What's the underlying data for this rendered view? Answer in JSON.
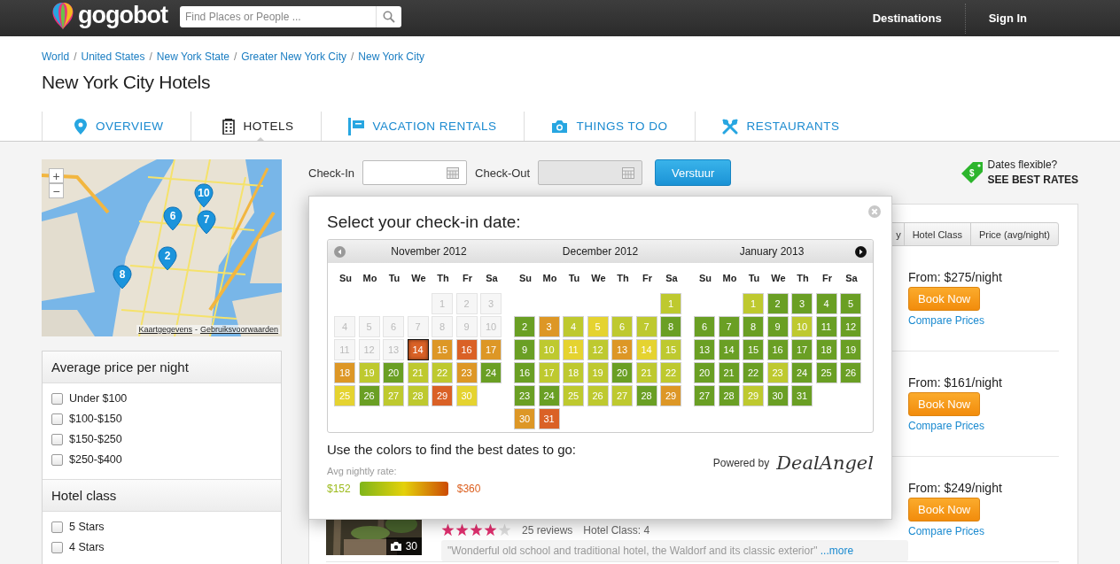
{
  "header": {
    "logo": "gogobot",
    "search": {
      "placeholder": "Find Places or People ..."
    },
    "links": [
      "Destinations",
      "Sign In"
    ]
  },
  "breadcrumb": {
    "separator": "/",
    "items": [
      "World",
      "United States",
      "New York State",
      "Greater New York City",
      "New York City"
    ]
  },
  "title": "New York City Hotels",
  "tabs": [
    {
      "label": "OVERVIEW",
      "kind": "pin",
      "selected": false
    },
    {
      "label": "HOTELS",
      "kind": "building",
      "selected": true
    },
    {
      "label": "VACATION RENTALS",
      "kind": "sign",
      "selected": false
    },
    {
      "label": "THINGS TO DO",
      "kind": "camera",
      "selected": false
    },
    {
      "label": "RESTAURANTS",
      "kind": "utensils",
      "selected": false
    }
  ],
  "map": {
    "zoom_in": "+",
    "zoom_out": "−",
    "markers": [
      "10",
      "6",
      "7",
      "2",
      "8"
    ],
    "links": [
      "Kaartgegevens",
      "Gebruiksvoorwaarden"
    ],
    "separator": "-"
  },
  "filters": [
    {
      "title": "Average price per night",
      "options": [
        {
          "label": "Under $100",
          "checked": false
        },
        {
          "label": "$100-$150",
          "checked": false
        },
        {
          "label": "$150-$250",
          "checked": false
        },
        {
          "label": "$250-$400",
          "checked": false
        }
      ]
    },
    {
      "title": "Hotel class",
      "options": [
        {
          "label": "5 Stars",
          "checked": false
        },
        {
          "label": "4 Stars",
          "checked": false
        }
      ]
    }
  ],
  "search_form": {
    "checkin_label": "Check-In",
    "checkout_label": "Check-Out",
    "checkout_disabled": true,
    "submit": "Verstuur"
  },
  "flexible": {
    "tag_symbol": "$",
    "question": "Dates flexible?",
    "link": "SEE BEST RATES"
  },
  "sort_buttons": [
    "y",
    "Hotel Class",
    "Price (avg/night)"
  ],
  "hotels": [
    {
      "price": "From: $275/night",
      "book": "Book Now",
      "compare": "Compare Prices"
    },
    {
      "price": "From: $161/night",
      "book": "Book Now",
      "compare": "Compare Prices"
    },
    {
      "price": "From: $249/night",
      "book": "Book Now",
      "compare": "Compare Prices",
      "photo_count": "30",
      "stars": 4,
      "reviews": "25 reviews",
      "hotel_class": "Hotel Class: 4",
      "quote": "\"Wonderful old school and traditional hotel, the Waldorf and its classic exterior\"",
      "more": "...more"
    }
  ],
  "datepicker": {
    "title": "Select your check-in date:",
    "months": [
      {
        "name": "November 2012",
        "weekdays": [
          "Su",
          "Mo",
          "Tu",
          "We",
          "Th",
          "Fr",
          "Sa"
        ],
        "weeks": [
          [
            {
              "kind": "blank"
            },
            {
              "kind": "blank"
            },
            {
              "kind": "blank"
            },
            {
              "kind": "blank"
            },
            {
              "kind": "day",
              "day": "1",
              "disabled": true,
              "selected": false
            },
            {
              "kind": "day",
              "day": "2",
              "disabled": true,
              "selected": false
            },
            {
              "kind": "day",
              "day": "3",
              "disabled": true,
              "selected": false
            }
          ],
          [
            {
              "kind": "day",
              "day": "4",
              "disabled": true,
              "selected": false
            },
            {
              "kind": "day",
              "day": "5",
              "disabled": true,
              "selected": false
            },
            {
              "kind": "day",
              "day": "6",
              "disabled": true,
              "selected": false
            },
            {
              "kind": "day",
              "day": "7",
              "disabled": true,
              "selected": false
            },
            {
              "kind": "day",
              "day": "8",
              "disabled": true,
              "selected": false
            },
            {
              "kind": "day",
              "day": "9",
              "disabled": true,
              "selected": false
            },
            {
              "kind": "day",
              "day": "10",
              "disabled": true,
              "selected": false
            }
          ],
          [
            {
              "kind": "day",
              "day": "11",
              "disabled": true,
              "selected": false
            },
            {
              "kind": "day",
              "day": "12",
              "disabled": true,
              "selected": false
            },
            {
              "kind": "day",
              "day": "13",
              "disabled": true,
              "selected": false
            },
            {
              "kind": "day",
              "day": "14",
              "disabled": false,
              "selected": true,
              "color": "#da6126"
            },
            {
              "kind": "day",
              "day": "15",
              "disabled": false,
              "selected": false,
              "color": "#dd9726"
            },
            {
              "kind": "day",
              "day": "16",
              "disabled": false,
              "selected": false,
              "color": "#da6126"
            },
            {
              "kind": "day",
              "day": "17",
              "disabled": false,
              "selected": false,
              "color": "#dd9726"
            }
          ],
          [
            {
              "kind": "day",
              "day": "18",
              "disabled": false,
              "selected": false,
              "color": "#dd9726"
            },
            {
              "kind": "day",
              "day": "19",
              "disabled": false,
              "selected": false,
              "color": "#bec92f"
            },
            {
              "kind": "day",
              "day": "20",
              "disabled": false,
              "selected": false,
              "color": "#6a9f24"
            },
            {
              "kind": "day",
              "day": "21",
              "disabled": false,
              "selected": false,
              "color": "#bec92f"
            },
            {
              "kind": "day",
              "day": "22",
              "disabled": false,
              "selected": false,
              "color": "#bec92f"
            },
            {
              "kind": "day",
              "day": "23",
              "disabled": false,
              "selected": false,
              "color": "#dd9726"
            },
            {
              "kind": "day",
              "day": "24",
              "disabled": false,
              "selected": false,
              "color": "#6a9f24"
            }
          ],
          [
            {
              "kind": "day",
              "day": "25",
              "disabled": false,
              "selected": false,
              "color": "#e5d330"
            },
            {
              "kind": "day",
              "day": "26",
              "disabled": false,
              "selected": false,
              "color": "#6a9f24"
            },
            {
              "kind": "day",
              "day": "27",
              "disabled": false,
              "selected": false,
              "color": "#bec92f"
            },
            {
              "kind": "day",
              "day": "28",
              "disabled": false,
              "selected": false,
              "color": "#bec92f"
            },
            {
              "kind": "day",
              "day": "29",
              "disabled": false,
              "selected": false,
              "color": "#da6126"
            },
            {
              "kind": "day",
              "day": "30",
              "disabled": false,
              "selected": false,
              "color": "#e5d330"
            }
          ]
        ]
      },
      {
        "name": "December 2012",
        "weekdays": [
          "Su",
          "Mo",
          "Tu",
          "We",
          "Th",
          "Fr",
          "Sa"
        ],
        "weeks": [
          [
            {
              "kind": "blank"
            },
            {
              "kind": "blank"
            },
            {
              "kind": "blank"
            },
            {
              "kind": "blank"
            },
            {
              "kind": "blank"
            },
            {
              "kind": "blank"
            },
            {
              "kind": "day",
              "day": "1",
              "disabled": false,
              "selected": false,
              "color": "#bec92f"
            }
          ],
          [
            {
              "kind": "day",
              "day": "2",
              "disabled": false,
              "selected": false,
              "color": "#6a9f24"
            },
            {
              "kind": "day",
              "day": "3",
              "disabled": false,
              "selected": false,
              "color": "#dd9726"
            },
            {
              "kind": "day",
              "day": "4",
              "disabled": false,
              "selected": false,
              "color": "#bec92f"
            },
            {
              "kind": "day",
              "day": "5",
              "disabled": false,
              "selected": false,
              "color": "#e5d330"
            },
            {
              "kind": "day",
              "day": "6",
              "disabled": false,
              "selected": false,
              "color": "#bec92f"
            },
            {
              "kind": "day",
              "day": "7",
              "disabled": false,
              "selected": false,
              "color": "#bec92f"
            },
            {
              "kind": "day",
              "day": "8",
              "disabled": false,
              "selected": false,
              "color": "#6a9f24"
            }
          ],
          [
            {
              "kind": "day",
              "day": "9",
              "disabled": false,
              "selected": false,
              "color": "#6a9f24"
            },
            {
              "kind": "day",
              "day": "10",
              "disabled": false,
              "selected": false,
              "color": "#bec92f"
            },
            {
              "kind": "day",
              "day": "11",
              "disabled": false,
              "selected": false,
              "color": "#e5d330"
            },
            {
              "kind": "day",
              "day": "12",
              "disabled": false,
              "selected": false,
              "color": "#bec92f"
            },
            {
              "kind": "day",
              "day": "13",
              "disabled": false,
              "selected": false,
              "color": "#dd9726"
            },
            {
              "kind": "day",
              "day": "14",
              "disabled": false,
              "selected": false,
              "color": "#e5d330"
            },
            {
              "kind": "day",
              "day": "15",
              "disabled": false,
              "selected": false,
              "color": "#bec92f"
            }
          ],
          [
            {
              "kind": "day",
              "day": "16",
              "disabled": false,
              "selected": false,
              "color": "#6a9f24"
            },
            {
              "kind": "day",
              "day": "17",
              "disabled": false,
              "selected": false,
              "color": "#bec92f"
            },
            {
              "kind": "day",
              "day": "18",
              "disabled": false,
              "selected": false,
              "color": "#bec92f"
            },
            {
              "kind": "day",
              "day": "19",
              "disabled": false,
              "selected": false,
              "color": "#bec92f"
            },
            {
              "kind": "day",
              "day": "20",
              "disabled": false,
              "selected": false,
              "color": "#6a9f24"
            },
            {
              "kind": "day",
              "day": "21",
              "disabled": false,
              "selected": false,
              "color": "#bec92f"
            },
            {
              "kind": "day",
              "day": "22",
              "disabled": false,
              "selected": false,
              "color": "#bec92f"
            }
          ],
          [
            {
              "kind": "day",
              "day": "23",
              "disabled": false,
              "selected": false,
              "color": "#6a9f24"
            },
            {
              "kind": "day",
              "day": "24",
              "disabled": false,
              "selected": false,
              "color": "#6a9f24"
            },
            {
              "kind": "day",
              "day": "25",
              "disabled": false,
              "selected": false,
              "color": "#bec92f"
            },
            {
              "kind": "day",
              "day": "26",
              "disabled": false,
              "selected": false,
              "color": "#bec92f"
            },
            {
              "kind": "day",
              "day": "27",
              "disabled": false,
              "selected": false,
              "color": "#bec92f"
            },
            {
              "kind": "day",
              "day": "28",
              "disabled": false,
              "selected": false,
              "color": "#6a9f24"
            },
            {
              "kind": "day",
              "day": "29",
              "disabled": false,
              "selected": false,
              "color": "#dd9726"
            }
          ],
          [
            {
              "kind": "day",
              "day": "30",
              "disabled": false,
              "selected": false,
              "color": "#dd9726"
            },
            {
              "kind": "day",
              "day": "31",
              "disabled": false,
              "selected": false,
              "color": "#da6126"
            }
          ]
        ]
      },
      {
        "name": "January 2013",
        "weekdays": [
          "Su",
          "Mo",
          "Tu",
          "We",
          "Th",
          "Fr",
          "Sa"
        ],
        "weeks": [
          [
            {
              "kind": "blank"
            },
            {
              "kind": "blank"
            },
            {
              "kind": "day",
              "day": "1",
              "disabled": false,
              "selected": false,
              "color": "#bec92f"
            },
            {
              "kind": "day",
              "day": "2",
              "disabled": false,
              "selected": false,
              "color": "#6a9f24"
            },
            {
              "kind": "day",
              "day": "3",
              "disabled": false,
              "selected": false,
              "color": "#6a9f24"
            },
            {
              "kind": "day",
              "day": "4",
              "disabled": false,
              "selected": false,
              "color": "#6a9f24"
            },
            {
              "kind": "day",
              "day": "5",
              "disabled": false,
              "selected": false,
              "color": "#6a9f24"
            }
          ],
          [
            {
              "kind": "day",
              "day": "6",
              "disabled": false,
              "selected": false,
              "color": "#6a9f24"
            },
            {
              "kind": "day",
              "day": "7",
              "disabled": false,
              "selected": false,
              "color": "#6a9f24"
            },
            {
              "kind": "day",
              "day": "8",
              "disabled": false,
              "selected": false,
              "color": "#6a9f24"
            },
            {
              "kind": "day",
              "day": "9",
              "disabled": false,
              "selected": false,
              "color": "#6a9f24"
            },
            {
              "kind": "day",
              "day": "10",
              "disabled": false,
              "selected": false,
              "color": "#bec92f"
            },
            {
              "kind": "day",
              "day": "11",
              "disabled": false,
              "selected": false,
              "color": "#6a9f24"
            },
            {
              "kind": "day",
              "day": "12",
              "disabled": false,
              "selected": false,
              "color": "#6a9f24"
            }
          ],
          [
            {
              "kind": "day",
              "day": "13",
              "disabled": false,
              "selected": false,
              "color": "#6a9f24"
            },
            {
              "kind": "day",
              "day": "14",
              "disabled": false,
              "selected": false,
              "color": "#6a9f24"
            },
            {
              "kind": "day",
              "day": "15",
              "disabled": false,
              "selected": false,
              "color": "#6a9f24"
            },
            {
              "kind": "day",
              "day": "16",
              "disabled": false,
              "selected": false,
              "color": "#6a9f24"
            },
            {
              "kind": "day",
              "day": "17",
              "disabled": false,
              "selected": false,
              "color": "#6a9f24"
            },
            {
              "kind": "day",
              "day": "18",
              "disabled": false,
              "selected": false,
              "color": "#6a9f24"
            },
            {
              "kind": "day",
              "day": "19",
              "disabled": false,
              "selected": false,
              "color": "#6a9f24"
            }
          ],
          [
            {
              "kind": "day",
              "day": "20",
              "disabled": false,
              "selected": false,
              "color": "#6a9f24"
            },
            {
              "kind": "day",
              "day": "21",
              "disabled": false,
              "selected": false,
              "color": "#6a9f24"
            },
            {
              "kind": "day",
              "day": "22",
              "disabled": false,
              "selected": false,
              "color": "#6a9f24"
            },
            {
              "kind": "day",
              "day": "23",
              "disabled": false,
              "selected": false,
              "color": "#bec92f"
            },
            {
              "kind": "day",
              "day": "24",
              "disabled": false,
              "selected": false,
              "color": "#6a9f24"
            },
            {
              "kind": "day",
              "day": "25",
              "disabled": false,
              "selected": false,
              "color": "#6a9f24"
            },
            {
              "kind": "day",
              "day": "26",
              "disabled": false,
              "selected": false,
              "color": "#6a9f24"
            }
          ],
          [
            {
              "kind": "day",
              "day": "27",
              "disabled": false,
              "selected": false,
              "color": "#6a9f24"
            },
            {
              "kind": "day",
              "day": "28",
              "disabled": false,
              "selected": false,
              "color": "#6a9f24"
            },
            {
              "kind": "day",
              "day": "29",
              "disabled": false,
              "selected": false,
              "color": "#bec92f"
            },
            {
              "kind": "day",
              "day": "30",
              "disabled": false,
              "selected": false,
              "color": "#6a9f24"
            },
            {
              "kind": "day",
              "day": "31",
              "disabled": false,
              "selected": false,
              "color": "#6a9f24"
            }
          ]
        ]
      }
    ],
    "legend": "Use the colors to find the best dates to go:",
    "rate_label": "Avg nightly rate:",
    "low": "$152",
    "high": "$360",
    "powered_by": "Powered by",
    "brand": "DealAngel"
  }
}
